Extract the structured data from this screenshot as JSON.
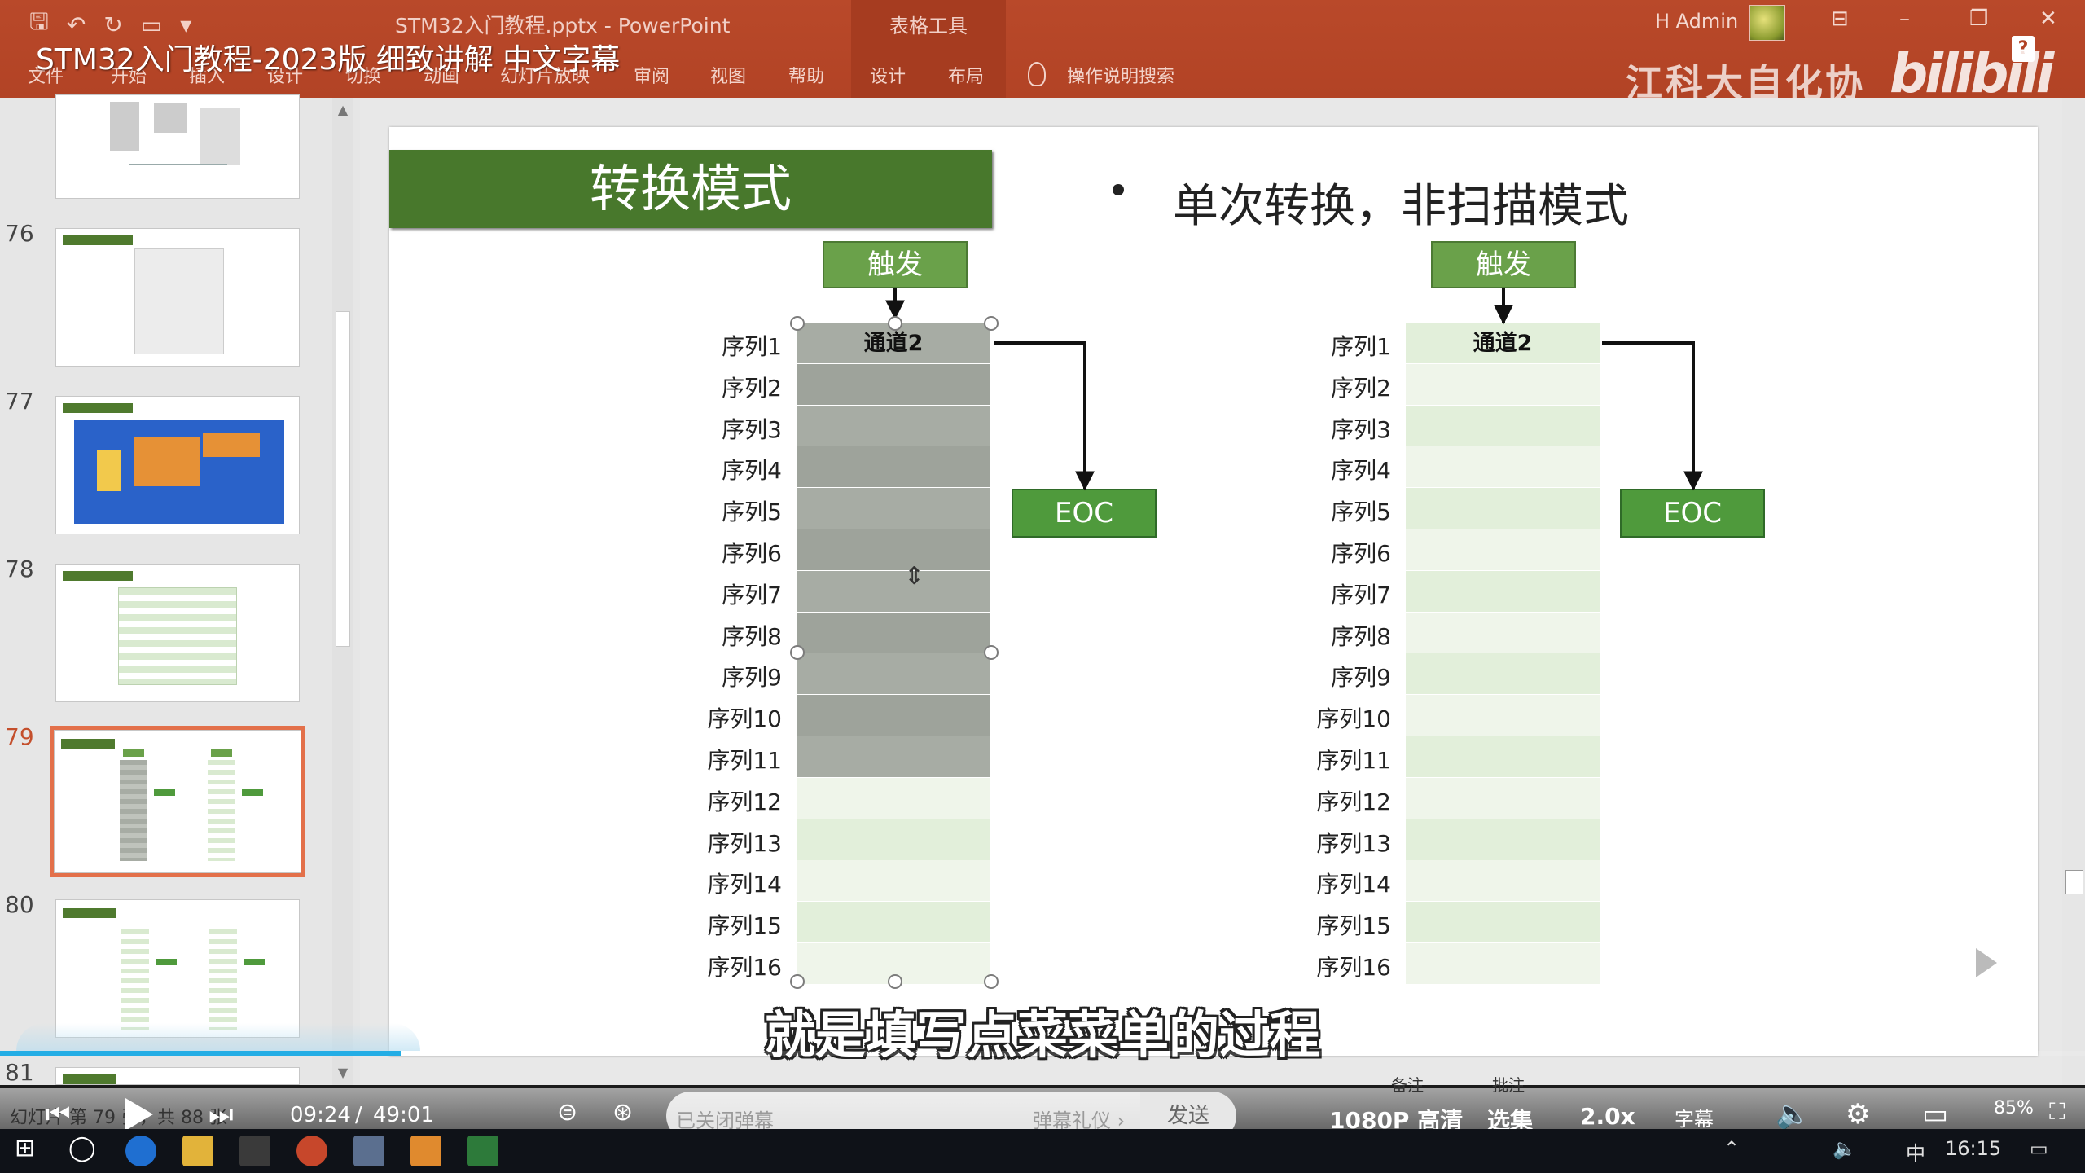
{
  "app": {
    "doc_title": "STM32入门教程.pptx - PowerPoint",
    "context_tab": "表格工具",
    "user_name": "H Admin",
    "ribbon_tabs": [
      "文件",
      "开始",
      "插入",
      "设计",
      "切换",
      "动画",
      "幻灯片放映",
      "审阅",
      "视图",
      "帮助",
      "设计",
      "布局",
      "操作说明搜索"
    ],
    "win_min": "–",
    "win_restore": "❐",
    "win_close": "✕",
    "help": "?"
  },
  "video": {
    "title": "STM32入门教程-2023版 细致讲解 中文字幕",
    "watermark": "江科大自化协",
    "logo": "bilibili",
    "subtitle": "就是填写点菜菜单的过程",
    "current_time": "09:24",
    "duration": "49:01",
    "time_sep": "/",
    "danmaku_placeholder": "已关闭弹幕",
    "danmaku_gift": "弹幕礼仪 ›",
    "send": "发送",
    "quality": "1080P 高清",
    "episodes": "选集",
    "speed": "2.0x",
    "subtitle_btn": "字幕",
    "progress": 0.192
  },
  "slide_pane": {
    "thumbnails": [
      {
        "number": "",
        "active": false
      },
      {
        "number": "76",
        "active": false
      },
      {
        "number": "77",
        "active": false
      },
      {
        "number": "78",
        "active": false
      },
      {
        "number": "79",
        "active": true
      },
      {
        "number": "80",
        "active": false
      },
      {
        "number": "81",
        "active": false
      }
    ]
  },
  "status_bar": {
    "slide_info": "幻灯片 第 79 张，共 88 张",
    "notes": "备注",
    "comments": "批注",
    "zoom": "85%"
  },
  "slide": {
    "title": "转换模式",
    "bullet": "单次转换，非扫描模式",
    "trigger_label": "触发",
    "eoc_label": "EOC",
    "cell_text": "通道2",
    "sequences": [
      "序列1",
      "序列2",
      "序列3",
      "序列4",
      "序列5",
      "序列6",
      "序列7",
      "序列8",
      "序列9",
      "序列10",
      "序列11",
      "序列12",
      "序列13",
      "序列14",
      "序列15",
      "序列16"
    ],
    "left_selected_rows": 11
  },
  "taskbar": {
    "clock": "16:15",
    "ime": "中"
  },
  "colors": {
    "ribbon": "#b24325",
    "title_green": "#48782c",
    "trigger_green": "#6aa14a",
    "eoc_green": "#4f9a3c",
    "row_light": "#e2efda",
    "row_lighter": "#eff5ea",
    "row_selected": "#a7aca4",
    "row_selected_alt": "#9ea39b",
    "progress": "#23ade5"
  }
}
